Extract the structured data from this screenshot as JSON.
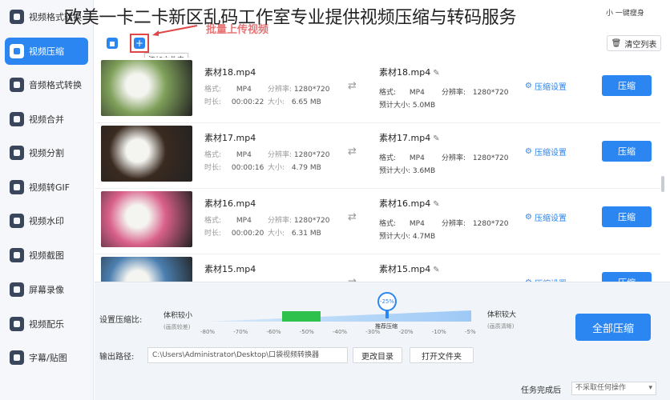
{
  "header": {
    "overlay_title": "欧美一卡二卡新区乱码工作室专业提供视频压缩与转码服务",
    "hint_text": "批量上传视频",
    "top_right": "小 一键瘦身"
  },
  "sidebar": {
    "items": [
      {
        "label": "视频格式转换",
        "active": false
      },
      {
        "label": "视频压缩",
        "active": true
      },
      {
        "label": "音频格式转换",
        "active": false
      },
      {
        "label": "视频合并",
        "active": false
      },
      {
        "label": "视频分割",
        "active": false
      },
      {
        "label": "视频转GIF",
        "active": false
      },
      {
        "label": "视频水印",
        "active": false
      },
      {
        "label": "视频截图",
        "active": false
      },
      {
        "label": "屏幕录像",
        "active": false
      },
      {
        "label": "视频配乐",
        "active": false
      },
      {
        "label": "字幕/贴图",
        "active": false
      }
    ]
  },
  "toolbar": {
    "add_file_icon": "file-icon",
    "add_folder_icon": "folder-plus-icon",
    "tooltip": "添加文件夹",
    "clear_label": "清空列表"
  },
  "labels": {
    "format": "格式:",
    "resolution": "分辨率:",
    "duration": "时长:",
    "size": "大小:",
    "estimated": "预计大小:",
    "settings": "压缩设置",
    "compress": "压缩"
  },
  "files": [
    {
      "name": "素材18.mp4",
      "format": "MP4",
      "resolution": "1280*720",
      "duration": "00:00:22",
      "size": "6.65 MB",
      "out_name": "素材18.mp4",
      "out_format": "MP4",
      "out_resolution": "1280*720",
      "est_size": "5.0MB",
      "thumb": "#7fa05a"
    },
    {
      "name": "素材17.mp4",
      "format": "MP4",
      "resolution": "1280*720",
      "duration": "00:00:16",
      "size": "4.79 MB",
      "out_name": "素材17.mp4",
      "out_format": "MP4",
      "out_resolution": "1280*720",
      "est_size": "3.6MB",
      "thumb": "#3a2a20"
    },
    {
      "name": "素材16.mp4",
      "format": "MP4",
      "resolution": "1280*720",
      "duration": "00:00:20",
      "size": "6.31 MB",
      "out_name": "素材16.mp4",
      "out_format": "MP4",
      "out_resolution": "1280*720",
      "est_size": "4.7MB",
      "thumb": "#d9608a"
    },
    {
      "name": "素材15.mp4",
      "format": "",
      "resolution": "",
      "duration": "",
      "size": "",
      "out_name": "素材15.mp4",
      "out_format": "",
      "out_resolution": "",
      "est_size": "",
      "thumb": "#4b7fb0"
    }
  ],
  "bottom": {
    "ratio_label": "设置压缩比:",
    "small_label": "体积较小",
    "small_note": "(画质较差)",
    "large_label": "体积较大",
    "large_note": "(画质清晰)",
    "marker_value": "-25%",
    "recommended": "推荐压缩",
    "ratio_fraction": 0.75,
    "ticks": [
      "-80%",
      "-70%",
      "-60%",
      "-50%",
      "-40%",
      "-30%",
      "-20%",
      "-10%",
      "-5%"
    ],
    "output_label": "输出路径:",
    "output_path": "C:\\Users\\Administrator\\Desktop\\口袋视频转换器",
    "change_dir": "更改目录",
    "open_folder": "打开文件夹",
    "compress_all": "全部压缩",
    "finish_label": "任务完成后",
    "finish_value": "不采取任何操作"
  },
  "colors": {
    "accent": "#2b86f2",
    "hint": "#e04848",
    "green": "#2ec24d"
  }
}
